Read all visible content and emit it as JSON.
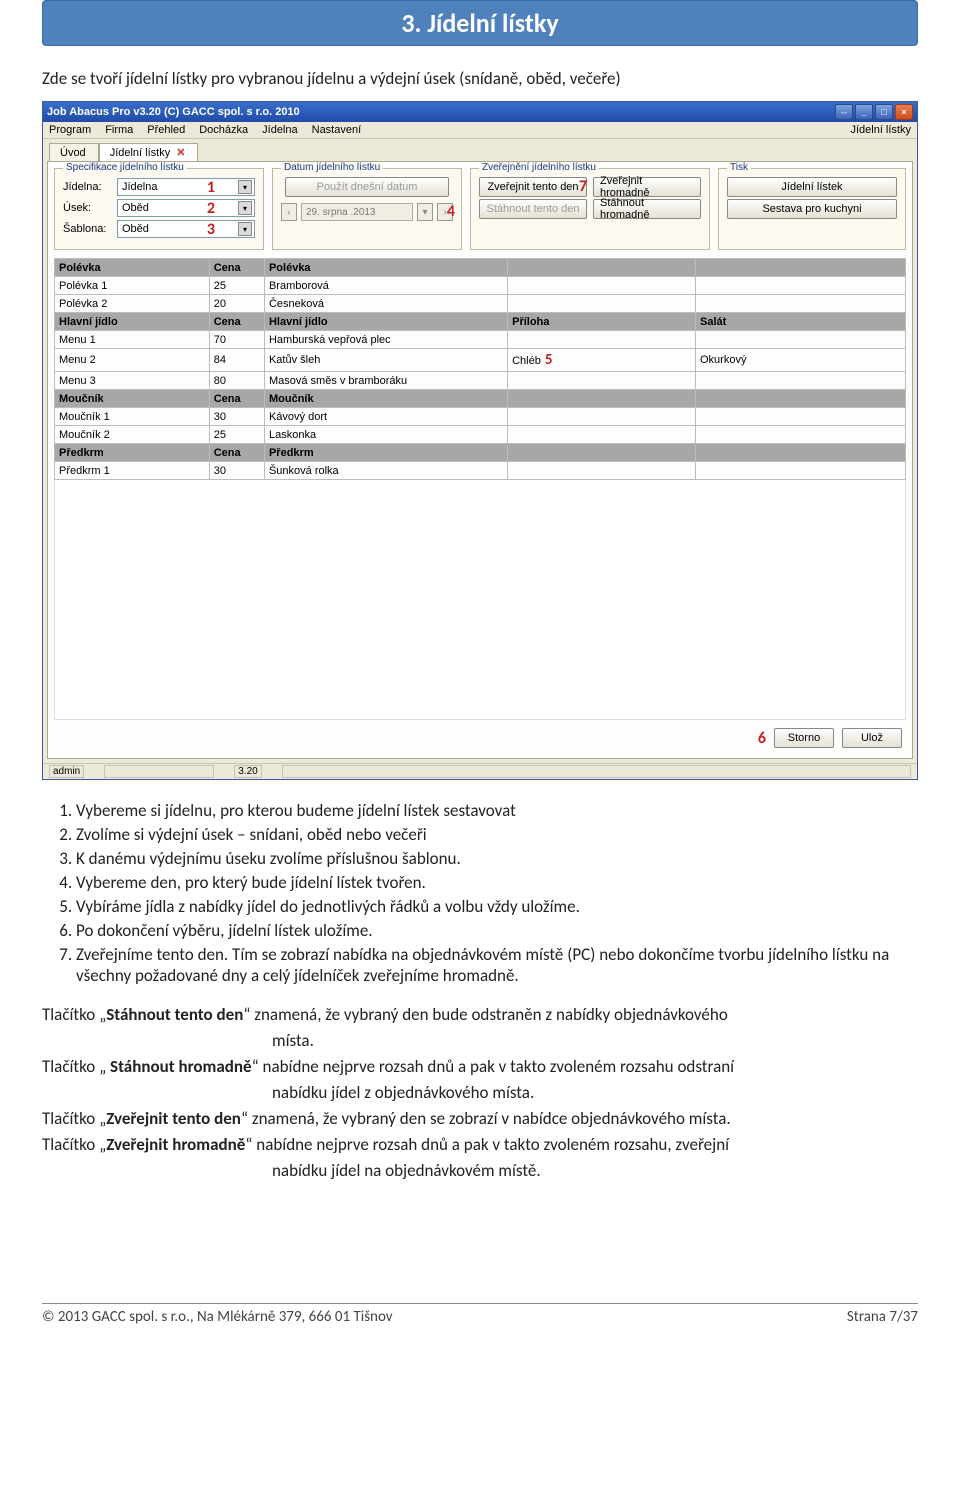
{
  "banner_title": "3. Jídelní lístky",
  "intro": "Zde se tvoří jídelní lístky pro vybranou jídelnu a výdejní úsek (snídaně, oběd, večeře)",
  "win": {
    "title": "Job Abacus Pro v3.20 (C) GACC spol. s r.o. 2010",
    "menu_left": [
      "Program",
      "Firma",
      "Přehled",
      "Docházka",
      "Jídelna",
      "Nastavení"
    ],
    "menu_right": "Jídelní lístky",
    "tabs": {
      "uvod": "Úvod",
      "jl": "Jídelní lístky"
    },
    "groups": {
      "spec": {
        "title": "Specifikace jídelního lístku",
        "jidelna_lbl": "Jídelna:",
        "jidelna_val": "Jídelna",
        "usek_lbl": "Úsek:",
        "usek_val": "Oběd",
        "sablona_lbl": "Šablona:",
        "sablona_val": "Oběd"
      },
      "date": {
        "title": "Datum jídelního lístku",
        "use_today": "Použít dnešní datum",
        "dateval": "29. srpna .2013"
      },
      "pub": {
        "title": "Zveřejnění jídelního lístku",
        "b1": "Zveřejnit tento den",
        "b2": "Zveřejnit hromadně",
        "b3": "Stáhnout tento den",
        "b4": "Stáhnout hromadně"
      },
      "print": {
        "title": "Tisk",
        "b1": "Jídelní lístek",
        "b2": "Sestava pro kuchyni"
      }
    },
    "table": {
      "sec1": [
        "Polévka",
        "Cena",
        "Polévka",
        "",
        ""
      ],
      "r1": [
        "Polévka 1",
        "25",
        "Bramborová",
        "",
        ""
      ],
      "r2": [
        "Polévka 2",
        "20",
        "Česneková",
        "",
        ""
      ],
      "sec2": [
        "Hlavní jídlo",
        "Cena",
        "Hlavní jídlo",
        "Příloha",
        "Salát"
      ],
      "r3": [
        "Menu 1",
        "70",
        "Hamburská vepřová plec",
        "",
        ""
      ],
      "r4": [
        "Menu 2",
        "84",
        "Katův šleh",
        "Chléb",
        "Okurkový"
      ],
      "r5": [
        "Menu 3",
        "80",
        "Masová směs v bramboráku",
        "",
        ""
      ],
      "sec3": [
        "Moučník",
        "Cena",
        "Moučník",
        "",
        ""
      ],
      "r6": [
        "Moučník 1",
        "30",
        "Kávový dort",
        "",
        ""
      ],
      "r7": [
        "Moučník 2",
        "25",
        "Laskonka",
        "",
        ""
      ],
      "sec4": [
        "Předkrm",
        "Cena",
        "Předkrm",
        "",
        ""
      ],
      "r8": [
        "Předkrm 1",
        "30",
        "Šunková rolka",
        "",
        ""
      ]
    },
    "storno": "Storno",
    "uloz": "Ulož",
    "status_user": "admin",
    "status_ver": "3.20"
  },
  "steps": [
    "Vybereme si jídelnu, pro kterou budeme jídelní lístek sestavovat",
    "Zvolíme si výdejní úsek – snídani, oběd nebo večeři",
    "K danému výdejnímu úseku zvolíme příslušnou šablonu.",
    "Vybereme den, pro který bude jídelní lístek tvořen.",
    "Vybíráme jídla z nabídky jídel do jednotlivých řádků a volbu vždy uložíme.",
    "Po dokončení výběru, jídelní lístek uložíme.",
    "Zveřejníme tento den. Tím se zobrazí nabídka na objednávkovém místě (PC) nebo dokončíme tvorbu jídelního lístku na všechny požadované dny a celý jídelníček zveřejníme hromadně."
  ],
  "defs": {
    "t1a": "Tlačítko „",
    "t1b": "Stáhnout tento den",
    "t1c": "“  znamená, že vybraný den bude odstraněn z nabídky objednávkového",
    "t1d": "místa.",
    "t2a": "Tlačítko „ ",
    "t2b": "Stáhnout hromadně",
    "t2c": "“ nabídne nejprve rozsah dnů a pak v takto zvoleném rozsahu odstraní",
    "t2d": "nabídku jídel z objednávkového místa.",
    "t3a": "Tlačítko „",
    "t3b": "Zveřejnit tento den",
    "t3c": "“  znamená, že vybraný den se zobrazí v nabídce objednávkového místa.",
    "t4a": "Tlačítko „",
    "t4b": "Zveřejnit hromadně",
    "t4c": "“ nabídne nejprve rozsah dnů a pak v takto zvoleném rozsahu, zveřejní",
    "t4d": "nabídku jídel na objednávkovém místě."
  },
  "footer": {
    "left": "© 2013 GACC spol. s r.o., Na Mlékárně 379, 666 01 Tišnov",
    "right": "Strana 7/37"
  }
}
